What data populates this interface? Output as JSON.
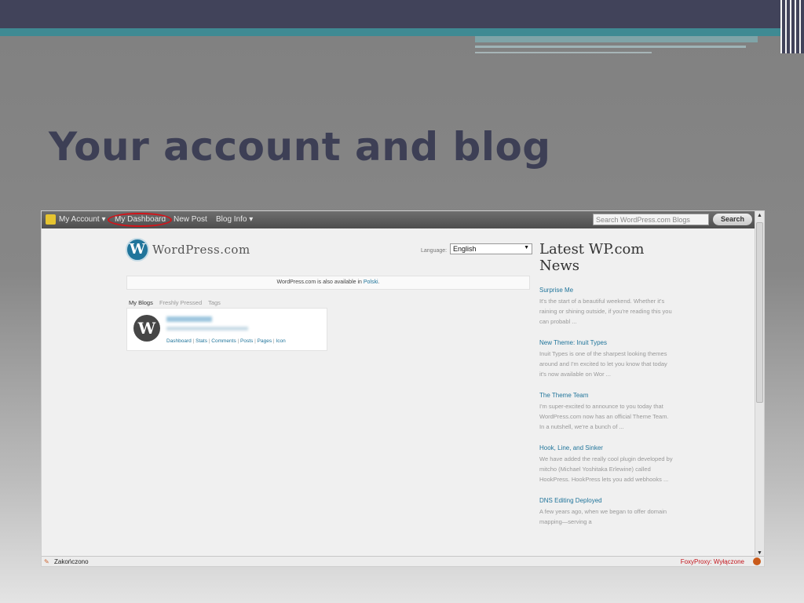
{
  "slide": {
    "title": "Your account and blog"
  },
  "adminbar": {
    "my_account": "My Account ▾",
    "my_dashboard": "My Dashboard",
    "new_post": "New Post",
    "blog_info": "Blog Info ▾",
    "search_placeholder": "Search WordPress.com Blogs",
    "search_button": "Search"
  },
  "branding": {
    "logo_letter": "W",
    "name": "WordPress.com"
  },
  "language": {
    "label": "Language:",
    "selected": "English"
  },
  "notice": {
    "text": "WordPress.com is also available in ",
    "link": "Polski",
    "suffix": "."
  },
  "tabs": {
    "my_blogs": "My Blogs",
    "freshly_pressed": "Freshly Pressed",
    "tags": "Tags"
  },
  "blog": {
    "avatar_letter": "W",
    "links": [
      "Dashboard",
      "Stats",
      "Comments",
      "Posts",
      "Pages",
      "Icon"
    ]
  },
  "news": {
    "title": "Latest WP.com News",
    "items": [
      {
        "title": "Surprise Me",
        "desc": "It's the start of a beautiful weekend. Whether it's raining or shining outside, if you're reading this you can probabl ..."
      },
      {
        "title": "New Theme: Inuit Types",
        "desc": "Inuit Types is one of the sharpest looking themes around and I'm excited to let you know that today it's now available on Wor ..."
      },
      {
        "title": "The Theme Team",
        "desc": "I'm super-excited to announce to you today that WordPress.com now has an official Theme Team. In a nutshell, we're a bunch of ..."
      },
      {
        "title": "Hook, Line, and Sinker",
        "desc": "We have added the really cool plugin developed by mitcho (Michael Yoshitaka Erlewine) called HookPress. HookPress lets you add webhooks ..."
      },
      {
        "title": "DNS Editing Deployed",
        "desc": "A few years ago, when we began to offer domain mapping—serving a"
      }
    ]
  },
  "statusbar": {
    "left": "Zakończono",
    "right": "FoxyProxy: Wyłączone"
  }
}
